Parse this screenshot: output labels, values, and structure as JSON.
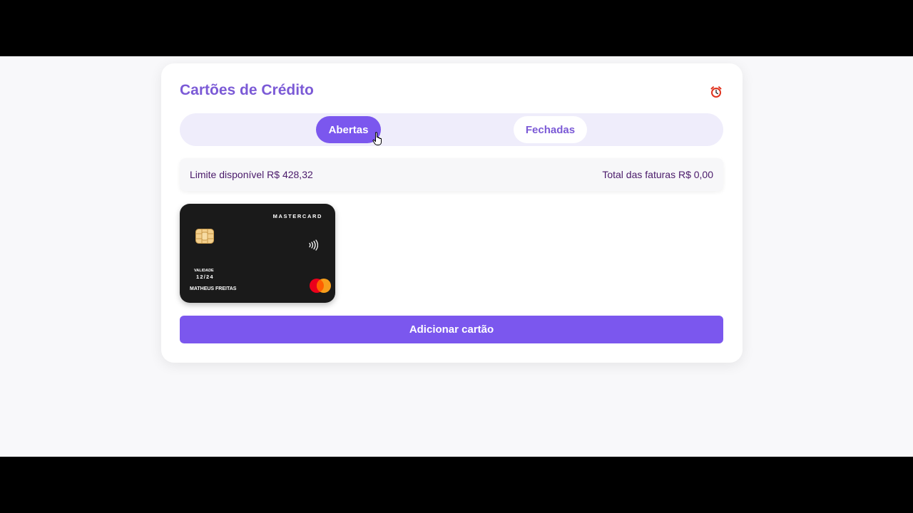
{
  "header": {
    "title": "Cartões de Crédito",
    "alarm_icon": "alarm-clock-icon"
  },
  "tabs": [
    {
      "label": "Abertas",
      "active": true
    },
    {
      "label": "Fechadas",
      "active": false
    }
  ],
  "summary": {
    "available_limit": "Limite disponível R$ 428,32",
    "invoices_total": "Total das faturas R$ 0,00"
  },
  "card": {
    "brand": "MASTERCARD",
    "validity_label": "VALIDADE",
    "validity_value": "12/24",
    "holder": "MATHEUS FREITAS",
    "background_color": "#1a1a1a"
  },
  "actions": {
    "add_card_label": "Adicionar cartão"
  },
  "colors": {
    "accent": "#7b57ee",
    "title": "#7b5ad6",
    "summary_text": "#4a1a6a"
  }
}
